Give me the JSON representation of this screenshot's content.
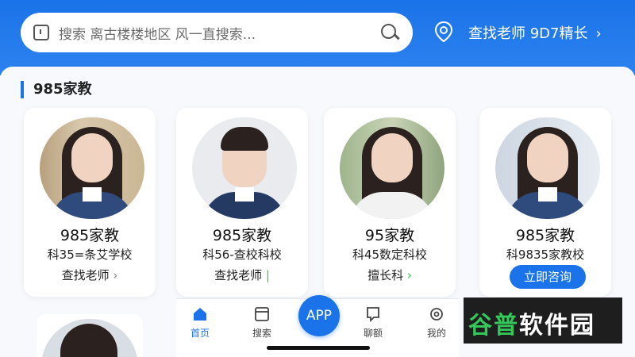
{
  "search": {
    "placeholder": "搜索 离古楼楼地区 风一直搜索..."
  },
  "header": {
    "finder_label": "查找老师 9D7精长",
    "location_icon": "location-pin-icon"
  },
  "section": {
    "title": "985家教"
  },
  "cards": [
    {
      "name": "985家教",
      "school": "科35=条艾学校",
      "action": "查找老师",
      "action_mark": "›"
    },
    {
      "name": "985家教",
      "school": "科56-查校科校",
      "action": "查找老师",
      "action_mark": "|"
    },
    {
      "name": "95家教",
      "school": "科45数定科校",
      "action": "擅长科",
      "action_mark": "›"
    },
    {
      "name": "985家教",
      "school": "科9835家教校",
      "button": "立即咨询"
    }
  ],
  "tabbar": {
    "items": [
      {
        "label": "首页",
        "icon": "home-icon"
      },
      {
        "label": "搜索",
        "icon": "book-icon"
      },
      {
        "label": "APP",
        "icon": "app-button"
      },
      {
        "label": "聊额",
        "icon": "chat-icon"
      },
      {
        "label": "我的",
        "icon": "profile-icon"
      }
    ]
  },
  "watermark": {
    "part1": "谷普",
    "part2": "软件园"
  },
  "colors": {
    "brand": "#1a73e8",
    "watermark_green": "#34c759"
  }
}
